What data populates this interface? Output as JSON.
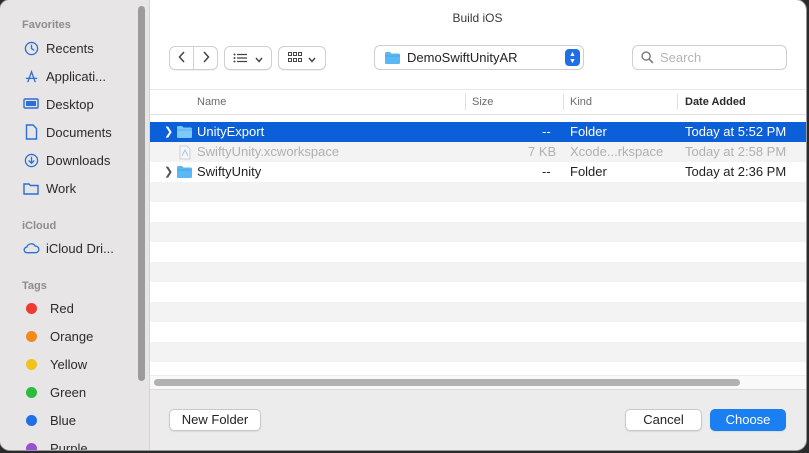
{
  "window": {
    "title": "Build iOS"
  },
  "sidebar": {
    "favorites_title": "Favorites",
    "favorites": [
      {
        "label": "Recents",
        "icon": "clock-icon"
      },
      {
        "label": "Applicati...",
        "icon": "applications-icon"
      },
      {
        "label": "Desktop",
        "icon": "desktop-icon"
      },
      {
        "label": "Documents",
        "icon": "document-icon"
      },
      {
        "label": "Downloads",
        "icon": "download-icon"
      },
      {
        "label": "Work",
        "icon": "folder-icon"
      }
    ],
    "icloud_title": "iCloud",
    "icloud": [
      {
        "label": "iCloud Dri...",
        "icon": "cloud-icon"
      }
    ],
    "tags_title": "Tags",
    "tags": [
      {
        "label": "Red",
        "color": "#ee3b30"
      },
      {
        "label": "Orange",
        "color": "#f08a1d"
      },
      {
        "label": "Yellow",
        "color": "#f1c21a"
      },
      {
        "label": "Green",
        "color": "#2cbb3c"
      },
      {
        "label": "Blue",
        "color": "#1f6fe6"
      },
      {
        "label": "Purple",
        "color": "#9b4fd1"
      }
    ]
  },
  "toolbar": {
    "path_label": "DemoSwiftUnityAR",
    "search_placeholder": "Search"
  },
  "columns": {
    "name": "Name",
    "size": "Size",
    "kind": "Kind",
    "date": "Date Added"
  },
  "files": [
    {
      "name": "UnityExport",
      "size": "--",
      "kind": "Folder",
      "date": "Today at 5:52 PM",
      "selected": true
    },
    {
      "name": "SwiftyUnity.xcworkspace",
      "size": "7 KB",
      "kind": "Xcode...rkspace",
      "date": "Today at 2:58 PM",
      "selected": false
    },
    {
      "name": "SwiftyUnity",
      "size": "--",
      "kind": "Folder",
      "date": "Today at 2:36 PM",
      "selected": false
    }
  ],
  "buttons": {
    "new_folder": "New Folder",
    "cancel": "Cancel",
    "choose": "Choose"
  },
  "colors": {
    "accent": "#1a7ff0",
    "selection": "#0b5fd8",
    "folder": "#5cb8f2"
  }
}
